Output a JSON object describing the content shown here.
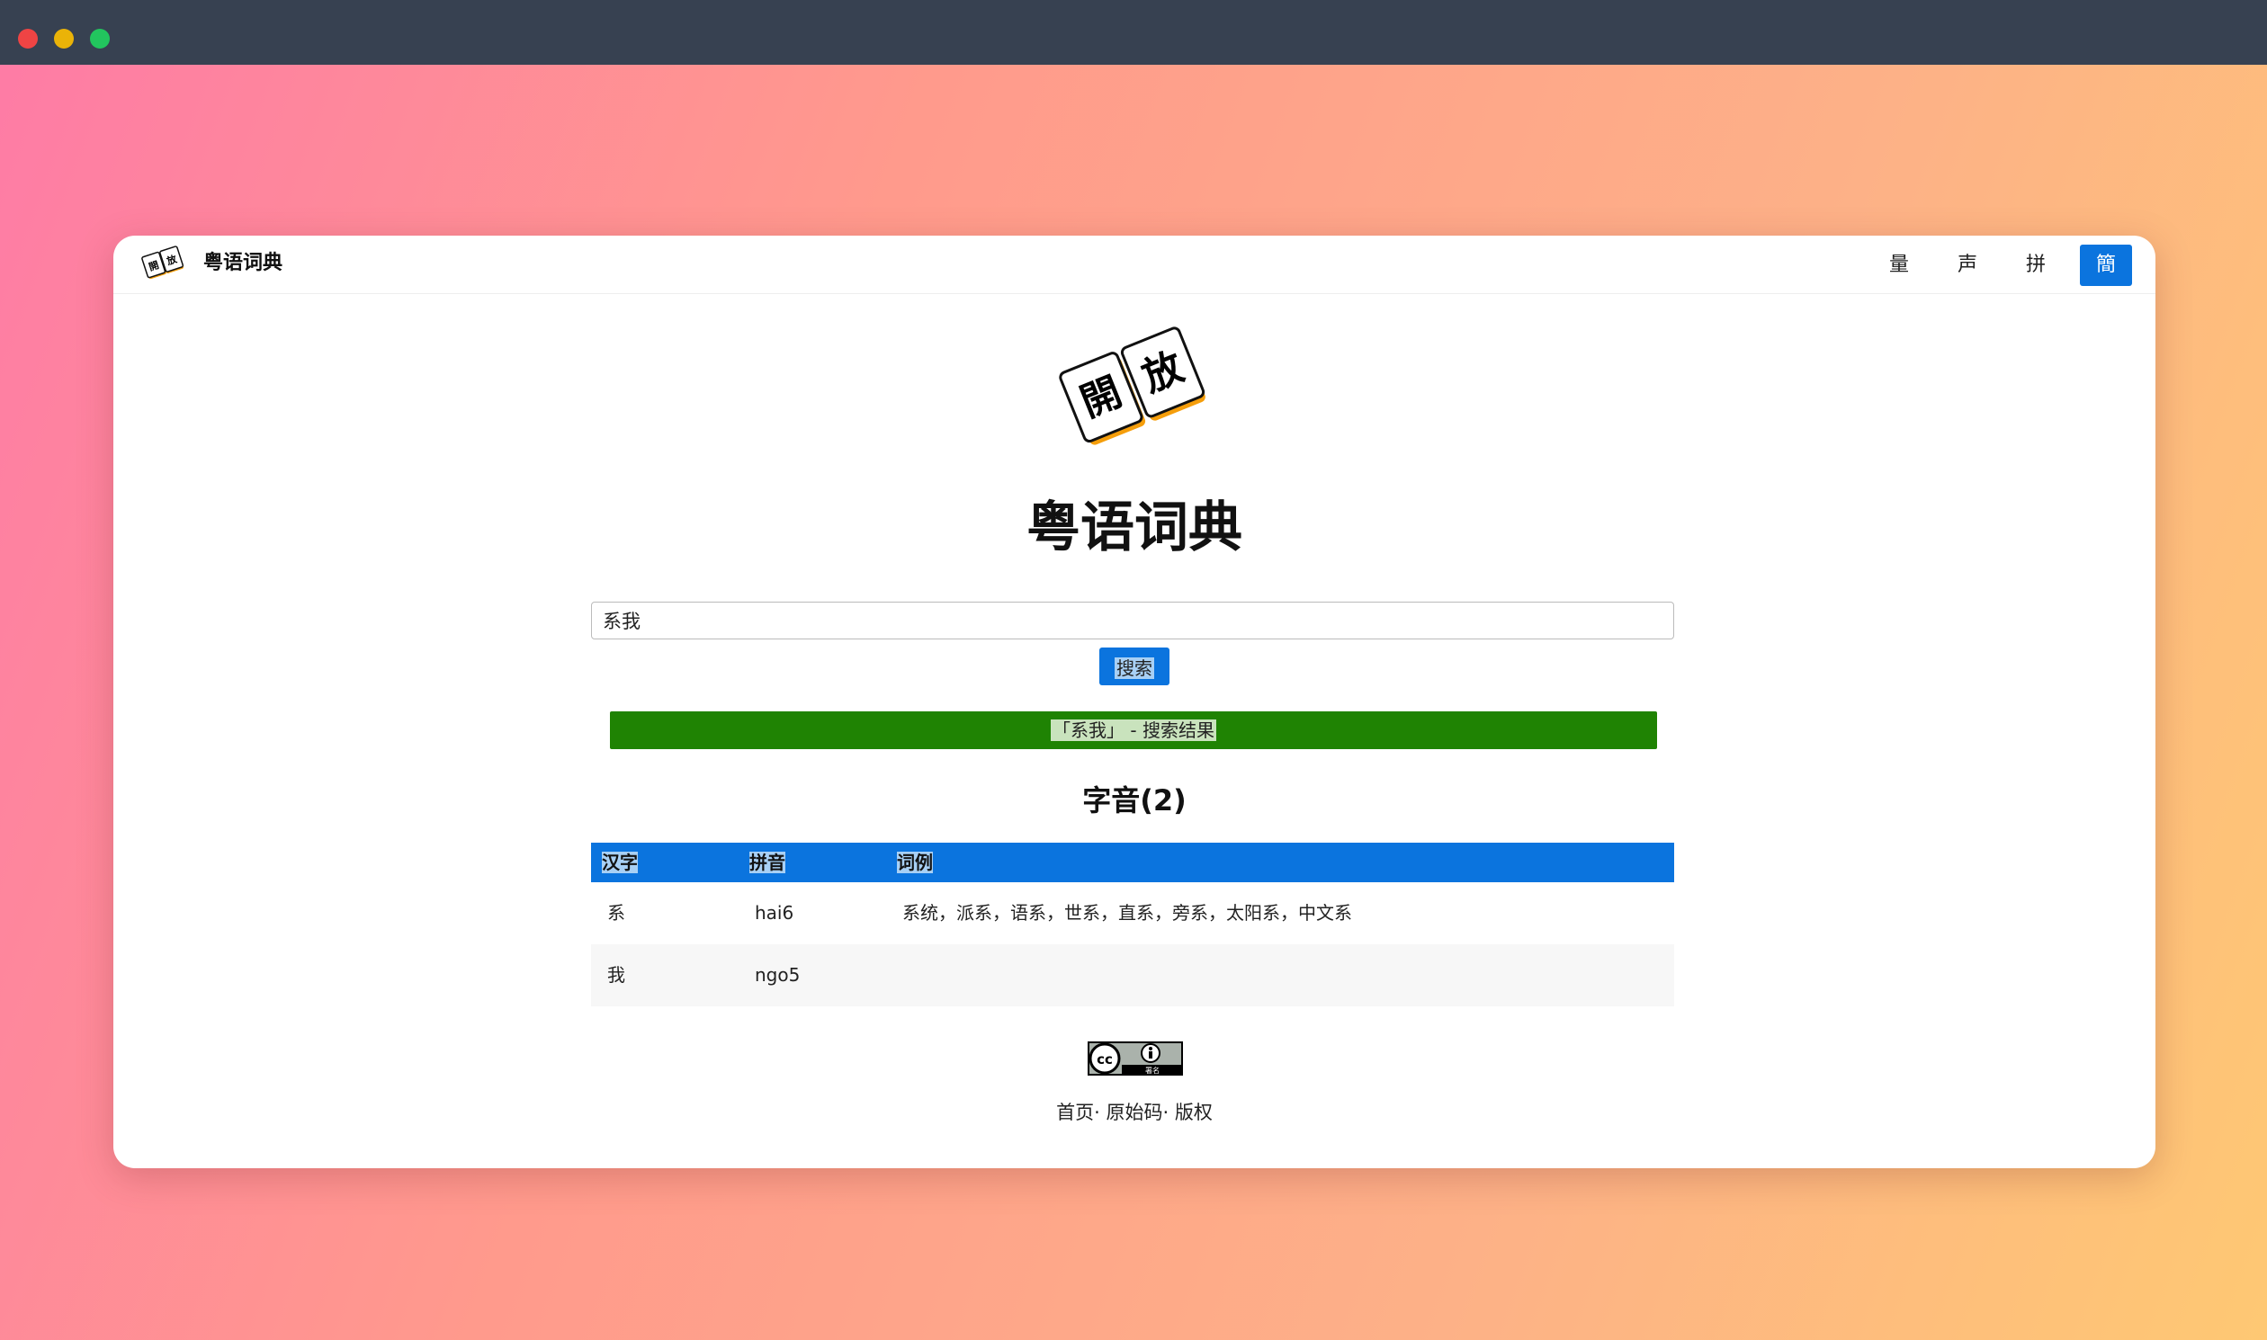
{
  "window_controls": [
    "close",
    "minimize",
    "maximize"
  ],
  "navbar": {
    "brand": "粤语词典",
    "logo_chars": [
      "開",
      "放"
    ],
    "buttons": [
      {
        "label": "量",
        "active": false
      },
      {
        "label": "声",
        "active": false
      },
      {
        "label": "拼",
        "active": false
      },
      {
        "label": "簡",
        "active": true
      }
    ]
  },
  "main": {
    "logo_chars": [
      "開",
      "放"
    ],
    "title": "粤语词典",
    "search": {
      "value": "系我",
      "button_label": "搜索"
    },
    "result_banner": "「系我」 - 搜索结果",
    "section_title": "字音(2)",
    "table": {
      "headers": [
        "汉字",
        "拼音",
        "词例"
      ],
      "rows": [
        {
          "char": "系",
          "pinyin": "hai6",
          "examples": "系统，派系，语系，世系，直系，旁系，太阳系，中文系"
        },
        {
          "char": "我",
          "pinyin": "ngo5",
          "examples": ""
        }
      ]
    }
  },
  "license_badge": {
    "icon": "cc-by-icon",
    "label": "署名"
  },
  "footer": {
    "text": "首页· 原始码· 版权"
  },
  "colors": {
    "accent": "#0b74de",
    "result_green": "#1f8303",
    "titlebar": "#374151",
    "logo_orange": "#f59e0b"
  }
}
